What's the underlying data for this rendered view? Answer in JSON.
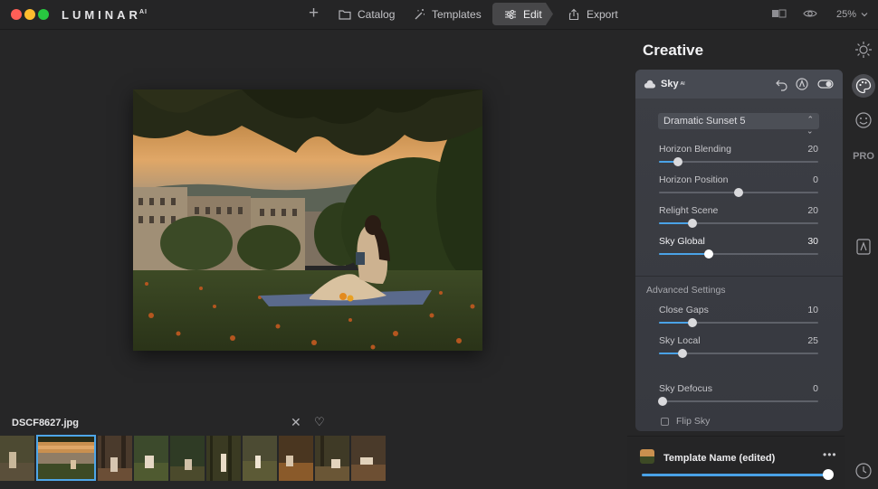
{
  "app": {
    "logo": "LUMINAR",
    "logo_sup": "AI"
  },
  "nav": {
    "plus": "+",
    "catalog": "Catalog",
    "templates": "Templates",
    "edit": "Edit",
    "export": "Export"
  },
  "view": {
    "zoom": "25%"
  },
  "image": {
    "filename": "DSCF8627.jpg"
  },
  "filmstrip": {
    "selected_index": 1,
    "count": 9
  },
  "panel": {
    "title": "Creative",
    "tool": {
      "name": "Sky",
      "name_suffix": "ᴬᴵ",
      "preset": "Dramatic Sunset 5",
      "sliders": [
        {
          "label": "Horizon Blending",
          "value": "20",
          "fraction": 0.12
        },
        {
          "label": "Horizon Position",
          "value": "0",
          "fraction": 0.5
        },
        {
          "label": "Relight Scene",
          "value": "20",
          "fraction": 0.21
        },
        {
          "label": "Sky Global",
          "value": "30",
          "fraction": 0.31
        }
      ],
      "advanced_title": "Advanced Settings",
      "advanced_sliders": [
        {
          "label": "Close Gaps",
          "value": "10",
          "fraction": 0.21
        },
        {
          "label": "Sky Local",
          "value": "25",
          "fraction": 0.15
        },
        {
          "label": "Sky Defocus",
          "value": "0",
          "fraction": 0.02
        }
      ],
      "flip_label": "Flip Sky",
      "flip_checked": false
    },
    "template": {
      "name": "Template Name (edited)",
      "more": "•••",
      "amount_fraction": 1.0
    }
  },
  "colors": {
    "accent": "#4aa2e6",
    "edit_active": "#474749"
  },
  "icons": {
    "sidebar": [
      "sun-icon",
      "palette-icon",
      "smile-icon",
      "pro-label",
      "crop-portrait-icon",
      "clock-icon"
    ],
    "pro_text": "PRO"
  }
}
